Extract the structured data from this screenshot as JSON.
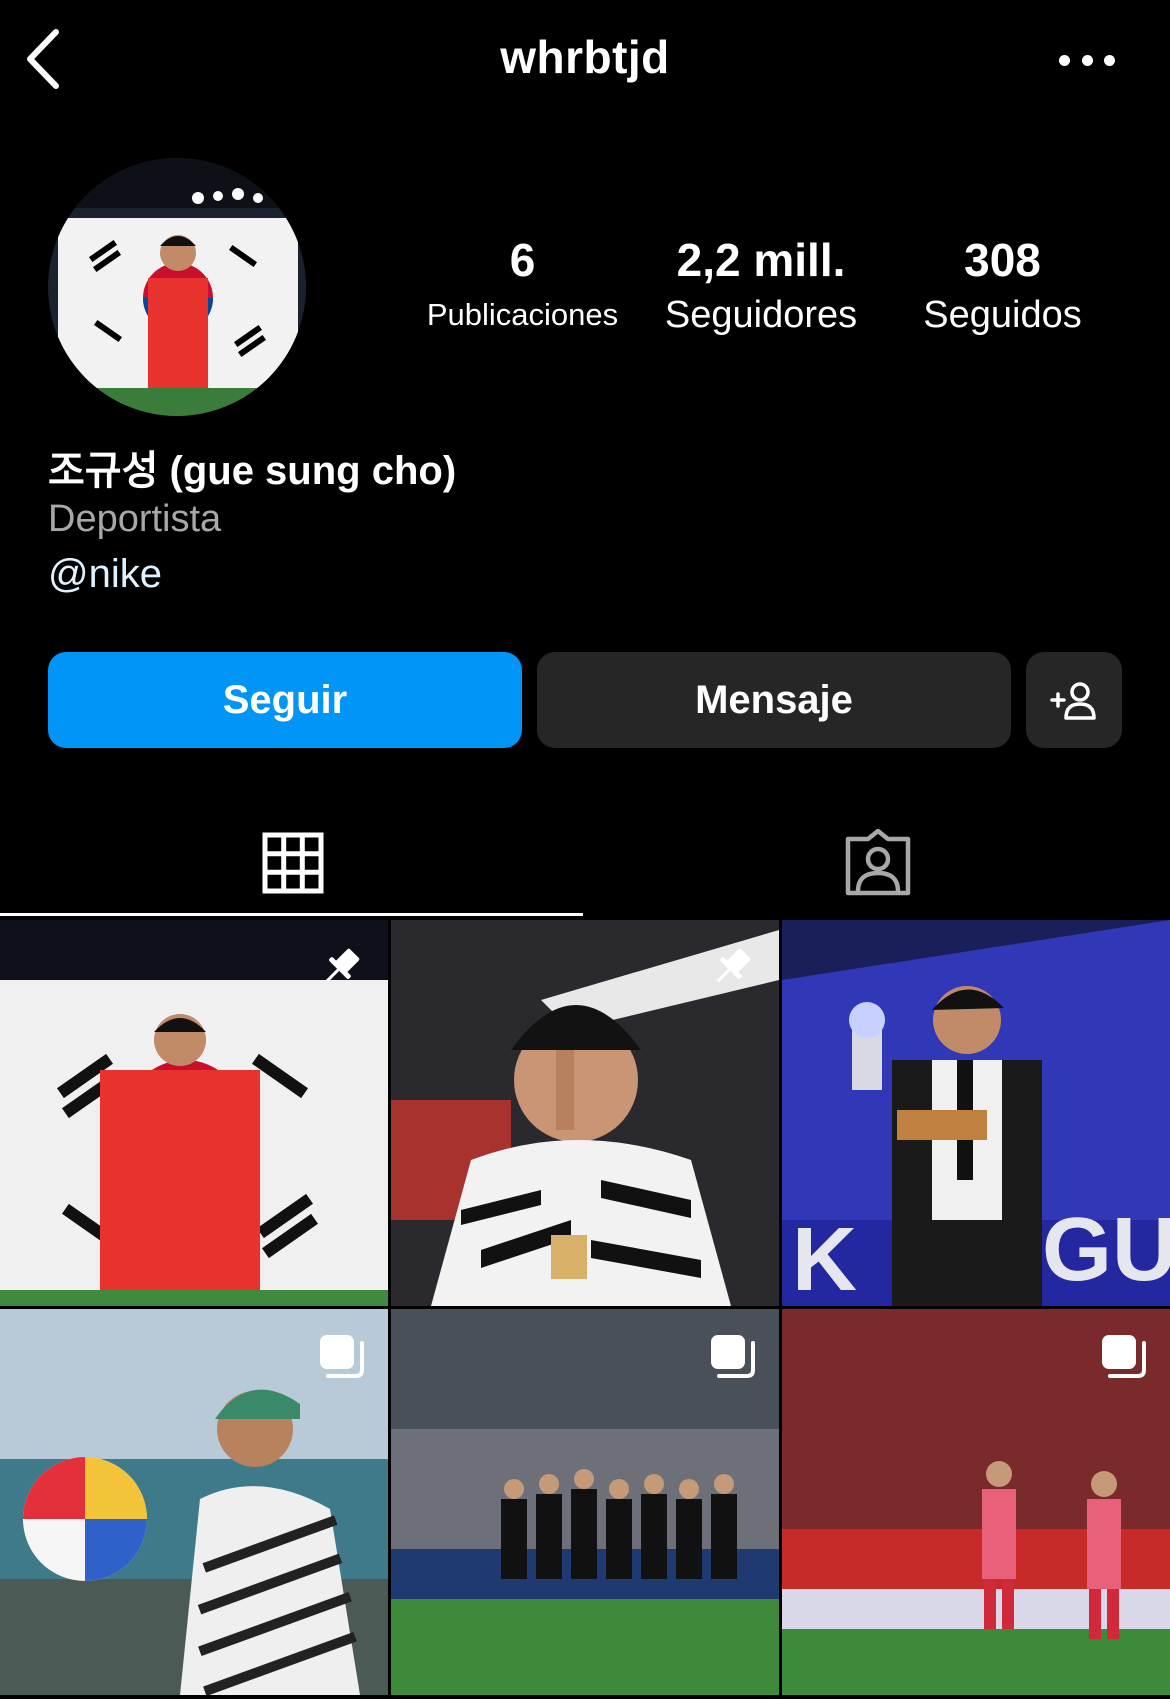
{
  "header": {
    "username": "whrbtjd",
    "back_icon": "chevron-left-icon",
    "more_icon": "more-horizontal-icon"
  },
  "profile": {
    "avatar_alt": "profile picture",
    "stats": {
      "posts": {
        "value": "6",
        "label": "Publicaciones"
      },
      "followers": {
        "value": "2,2 mill.",
        "label": "Seguidores"
      },
      "following": {
        "value": "308",
        "label": "Seguidos"
      }
    },
    "full_name": "조규성 (gue sung cho)",
    "category": "Deportista",
    "mention": "@nike"
  },
  "actions": {
    "follow_label": "Seguir",
    "message_label": "Mensaje",
    "suggest_icon": "add-person-icon"
  },
  "colors": {
    "background": "#000000",
    "follow_button": "#0095f6",
    "secondary_button": "#262626",
    "category_text": "#a8a8a8"
  },
  "tabs": [
    {
      "name": "posts-grid",
      "icon": "grid-icon",
      "active": true
    },
    {
      "name": "tagged",
      "icon": "tagged-person-icon",
      "active": false
    }
  ],
  "posts": [
    {
      "badge": "pin-icon"
    },
    {
      "badge": "pin-icon"
    },
    {
      "badge": ""
    },
    {
      "badge": "carousel-icon"
    },
    {
      "badge": "carousel-icon"
    },
    {
      "badge": "carousel-icon"
    }
  ]
}
